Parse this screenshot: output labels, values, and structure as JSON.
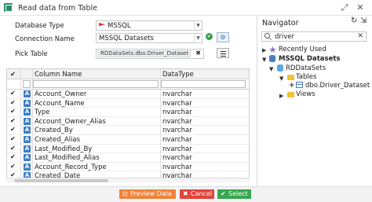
{
  "window": {
    "title": "Read data from Table",
    "icons": [
      "app-icon",
      "expand-icon",
      "close-icon"
    ]
  },
  "form": {
    "database_type_label": "Database Type",
    "database_type_value": "MSSQL",
    "connection_name_label": "Connection Name",
    "connection_name_value": "MSSQL Datasets",
    "pick_table_label": "Pick Table",
    "pick_table_value": "RDDataSets.dbo.Driver_Dataset",
    "clear_glyph": "✖",
    "connection_status_glyph": "✔",
    "settings_glyph": "⚙"
  },
  "grid": {
    "header_check": "✔",
    "column_header": "Column Name",
    "datatype_header": "DataType",
    "type_glyph": "A",
    "check_glyph": "✔",
    "rows": [
      {
        "name": "Account_Owner",
        "type": "nvarchar",
        "checked": true
      },
      {
        "name": "Account_Name",
        "type": "nvarchar",
        "checked": true
      },
      {
        "name": "Type",
        "type": "nvarchar",
        "checked": true
      },
      {
        "name": "Account_Owner_Alias",
        "type": "nvarchar",
        "checked": true
      },
      {
        "name": "Created_By",
        "type": "nvarchar",
        "checked": true
      },
      {
        "name": "Created_Alias",
        "type": "nvarchar",
        "checked": true
      },
      {
        "name": "Last_Modified_By",
        "type": "nvarchar",
        "checked": true
      },
      {
        "name": "Last_Modified_Alias",
        "type": "nvarchar",
        "checked": true
      },
      {
        "name": "Account_Record_Type",
        "type": "nvarchar",
        "checked": true
      },
      {
        "name": "Created_Date",
        "type": "nvarchar",
        "checked": true
      }
    ]
  },
  "navigator": {
    "title": "Navigator",
    "search_value": "driver",
    "refresh_glyph": "↻",
    "collapse_glyph": "⇲",
    "clear_glyph": "✕",
    "tree": {
      "recently_used": "Recently Used",
      "datasource": "MSSQL Datasets",
      "database": "RDDataSets",
      "tables": "Tables",
      "table": "dbo.Driver_Dataset",
      "views": "Views"
    }
  },
  "footer": {
    "preview_label": "Preview Data",
    "cancel_label": "Cancel",
    "select_label": "Select",
    "preview_glyph": "⊡",
    "cancel_glyph": "✖",
    "select_glyph": "✔"
  },
  "colors": {
    "preview": "#f0833a",
    "cancel": "#e0443a",
    "select": "#37a84f",
    "accent": "#3d7fc7"
  }
}
